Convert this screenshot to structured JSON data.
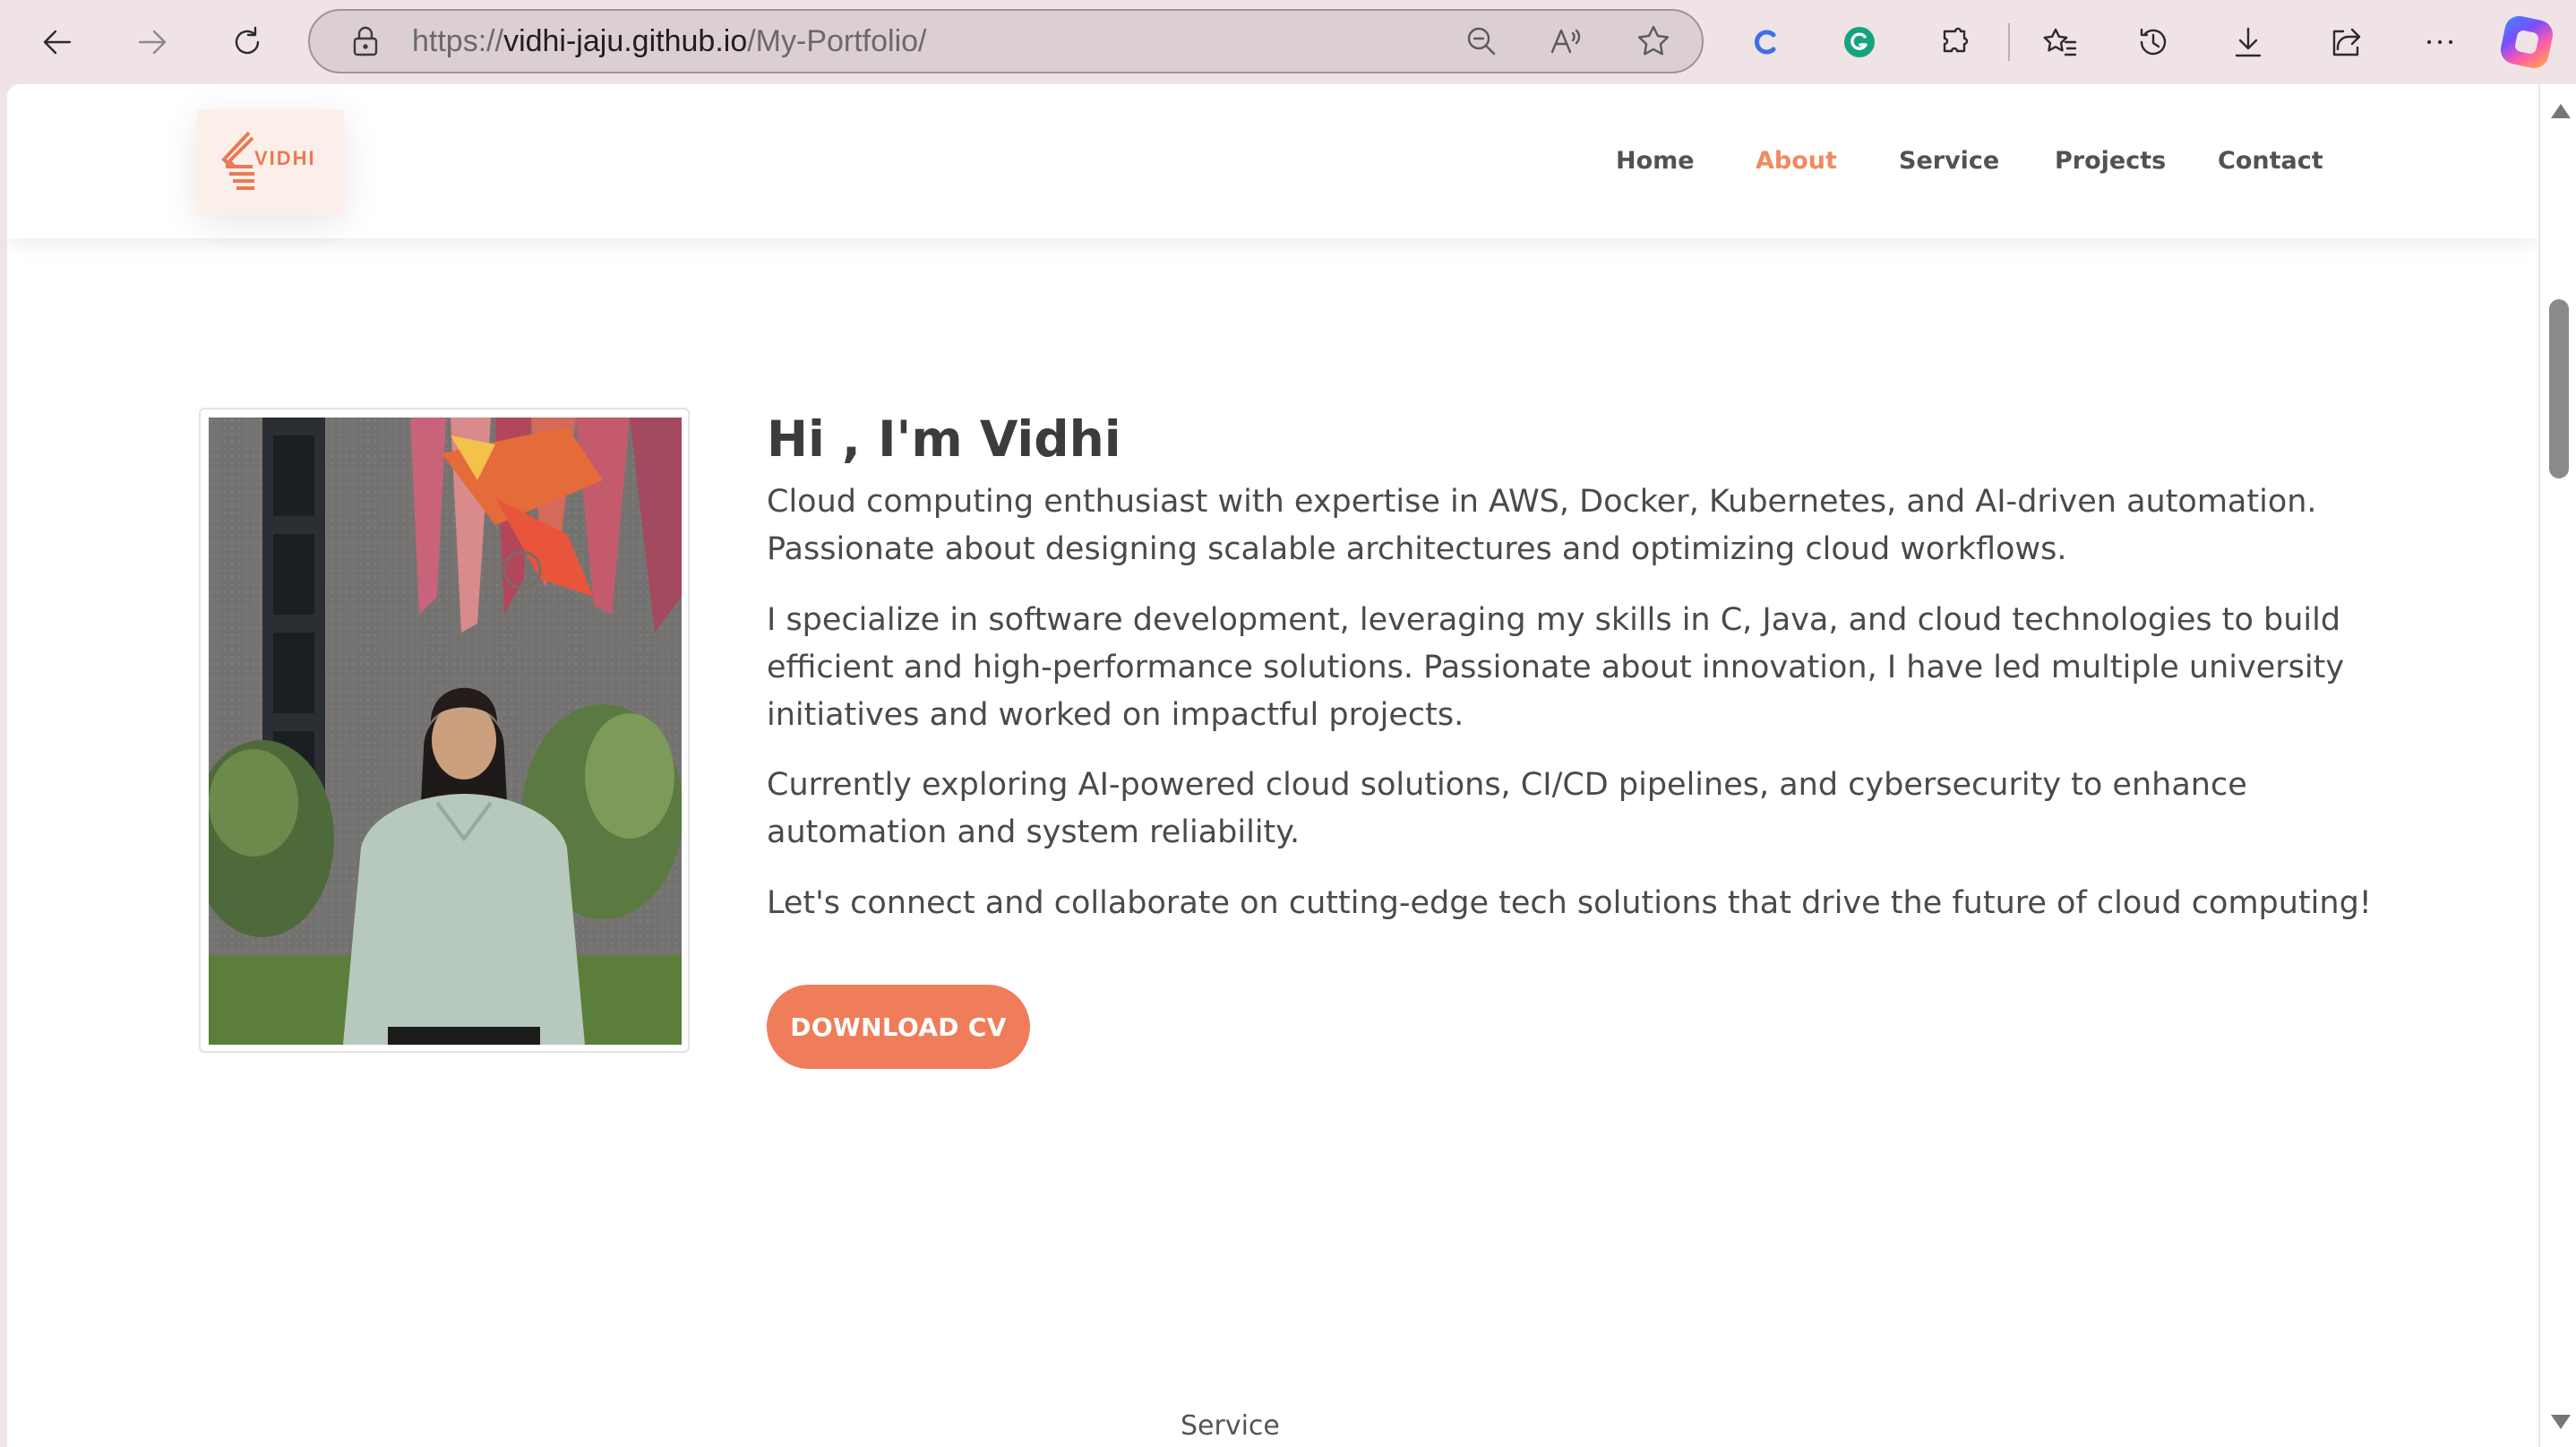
{
  "browser": {
    "url_prefix": "https://",
    "url_host": "vidhi-jaju.github.io",
    "url_path": "/My-Portfolio/",
    "icons": [
      "back-icon",
      "forward-icon",
      "refresh-icon",
      "lock-icon",
      "zoom-out-icon",
      "read-aloud-icon",
      "favorite-star-icon",
      "c-extension-icon",
      "grammarly-icon",
      "extensions-icon",
      "favorites-icon",
      "history-icon",
      "download-icon",
      "share-icon",
      "more-icon",
      "copilot-icon"
    ]
  },
  "site": {
    "logo_text": "VIDHI",
    "nav": [
      "Home",
      "About",
      "Service",
      "Projects",
      "Contact"
    ],
    "active_nav": "About",
    "accent_color": "#ef7d5a"
  },
  "about": {
    "title": "Hi , I'm Vidhi",
    "paragraphs": [
      "Cloud computing enthusiast with expertise in AWS, Docker, Kubernetes, and AI-driven automation. Passionate about designing scalable architectures and optimizing cloud workflows.",
      "I specialize in software development, leveraging my skills in C, Java, and cloud technologies to build efficient and high-performance solutions. Passionate about innovation, I have led multiple university initiatives and worked on impactful projects.",
      "Currently exploring AI-powered cloud solutions, CI/CD pipelines, and cybersecurity to enhance automation and system reliability.",
      "Let's connect and collaborate on cutting-edge tech solutions that drive the future of cloud computing!"
    ],
    "button_label": "DOWNLOAD CV"
  },
  "next_section_label": "Service"
}
